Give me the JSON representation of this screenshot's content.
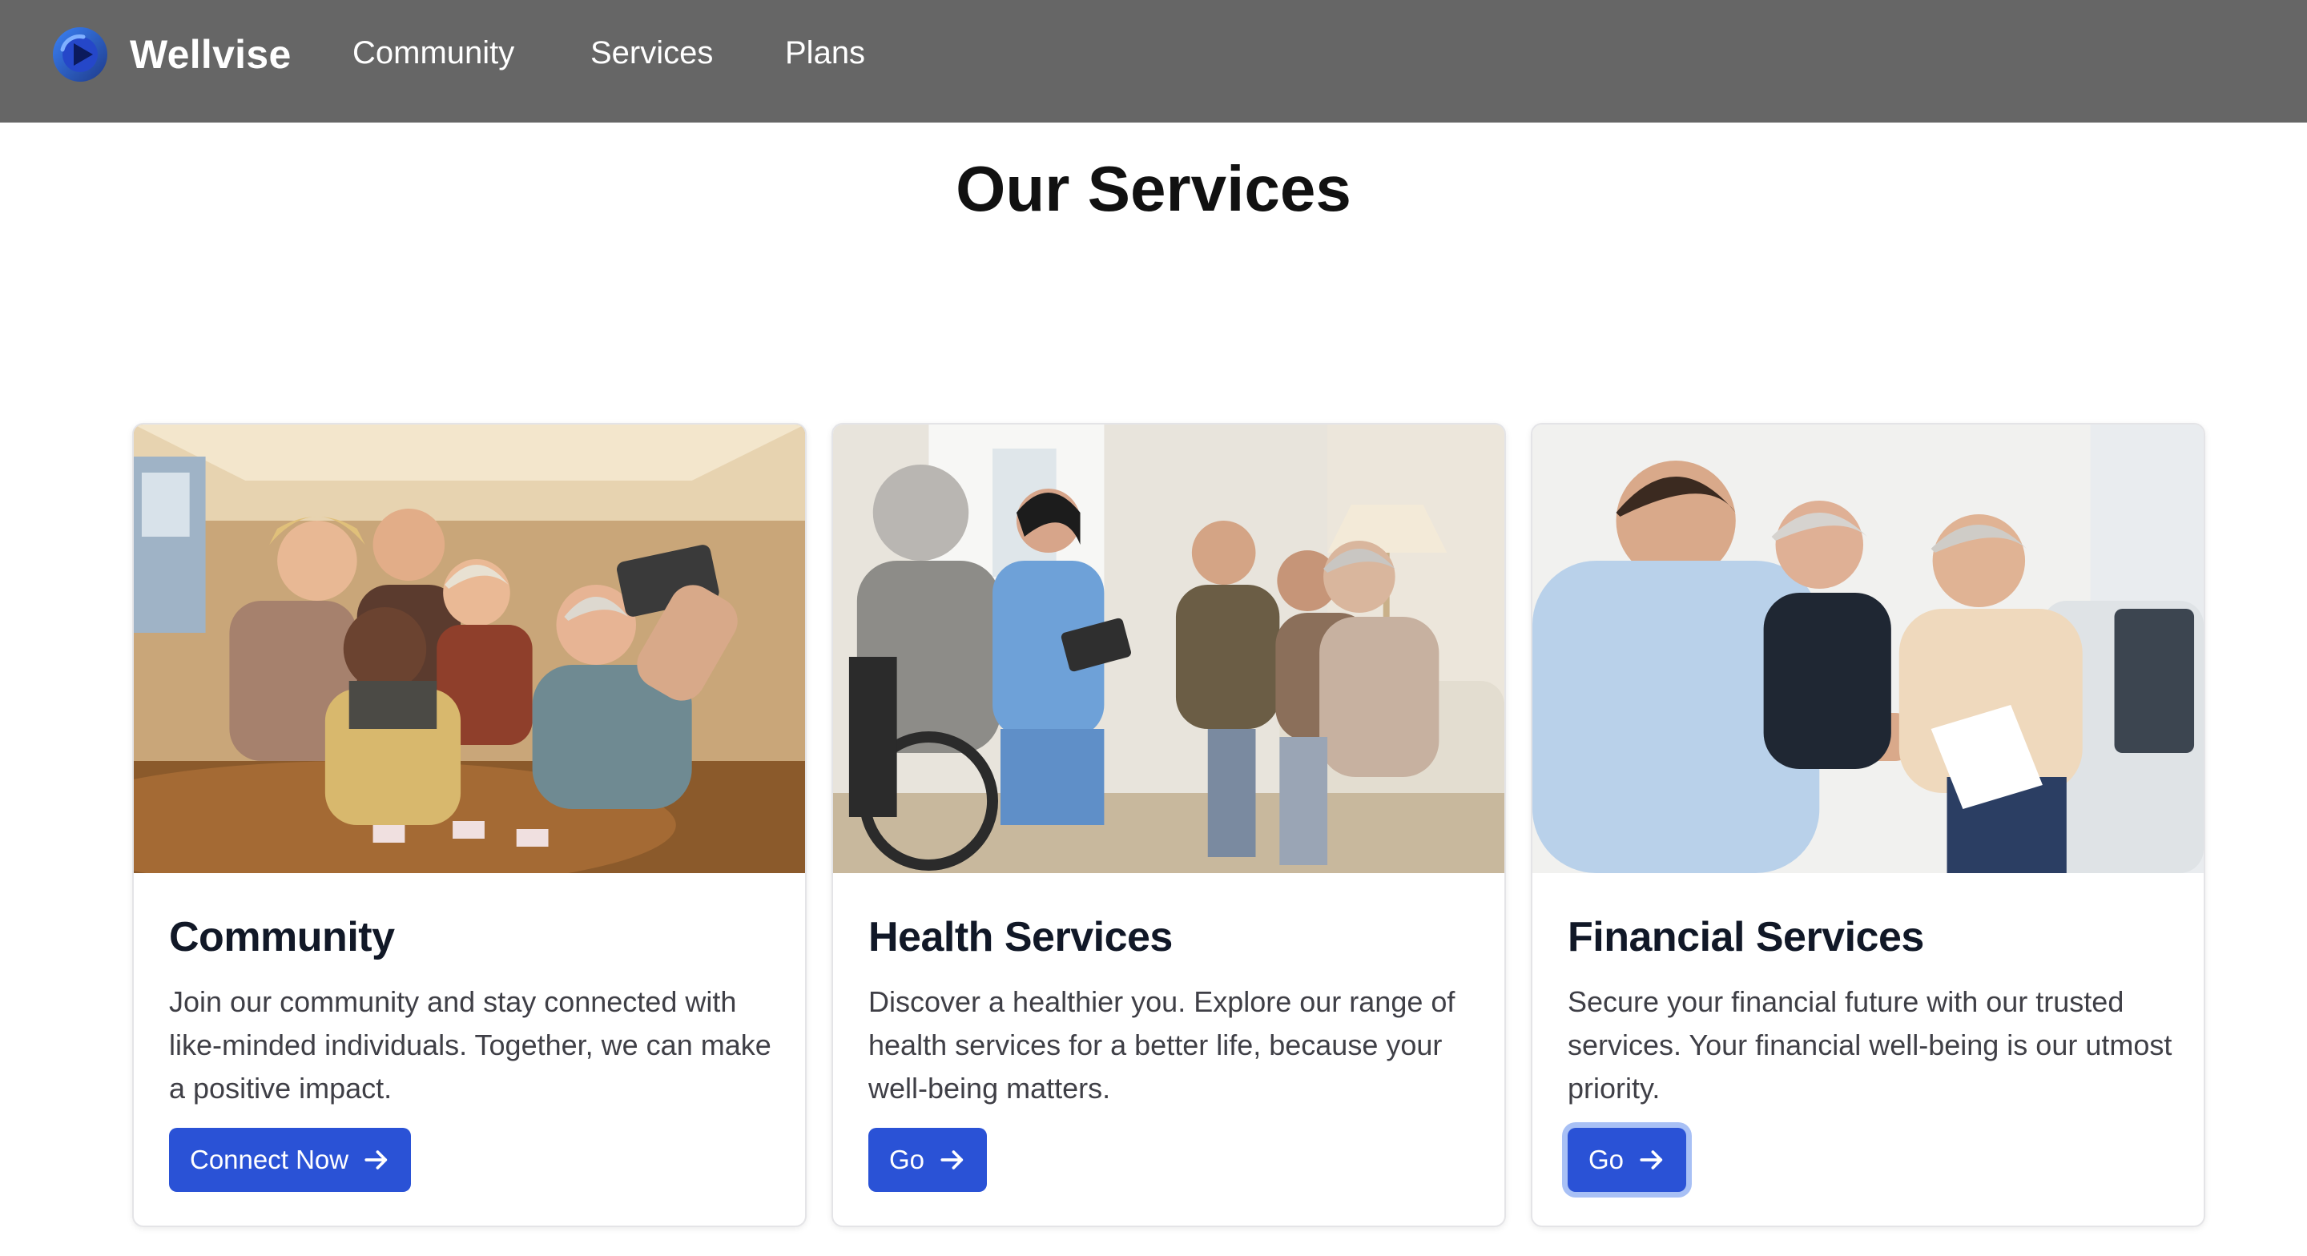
{
  "header": {
    "brand": "Wellvise",
    "nav": [
      "Community",
      "Services",
      "Plans"
    ]
  },
  "page": {
    "title": "Our Services"
  },
  "cards": [
    {
      "title": "Community",
      "description": "Join our community and stay connected with like-minded individuals. Together, we can make a positive impact.",
      "button": "Connect Now",
      "image_alt": "seniors-group-selfie-photo"
    },
    {
      "title": "Health Services",
      "description": "Discover a healthier you. Explore our range of health services for a better life, because your well-being matters.",
      "button": "Go",
      "image_alt": "nurse-with-seniors-photo"
    },
    {
      "title": "Financial Services",
      "description": "Secure your financial future with our trusted services. Your financial well-being is our utmost priority.",
      "button": "Go",
      "image_alt": "financial-advisor-with-couple-photo"
    }
  ],
  "colors": {
    "header_bg": "#666666",
    "button_bg": "#2a52d6",
    "focus_ring": "#a8c0f5",
    "title_text": "#111827",
    "body_text": "#3f3f46"
  }
}
